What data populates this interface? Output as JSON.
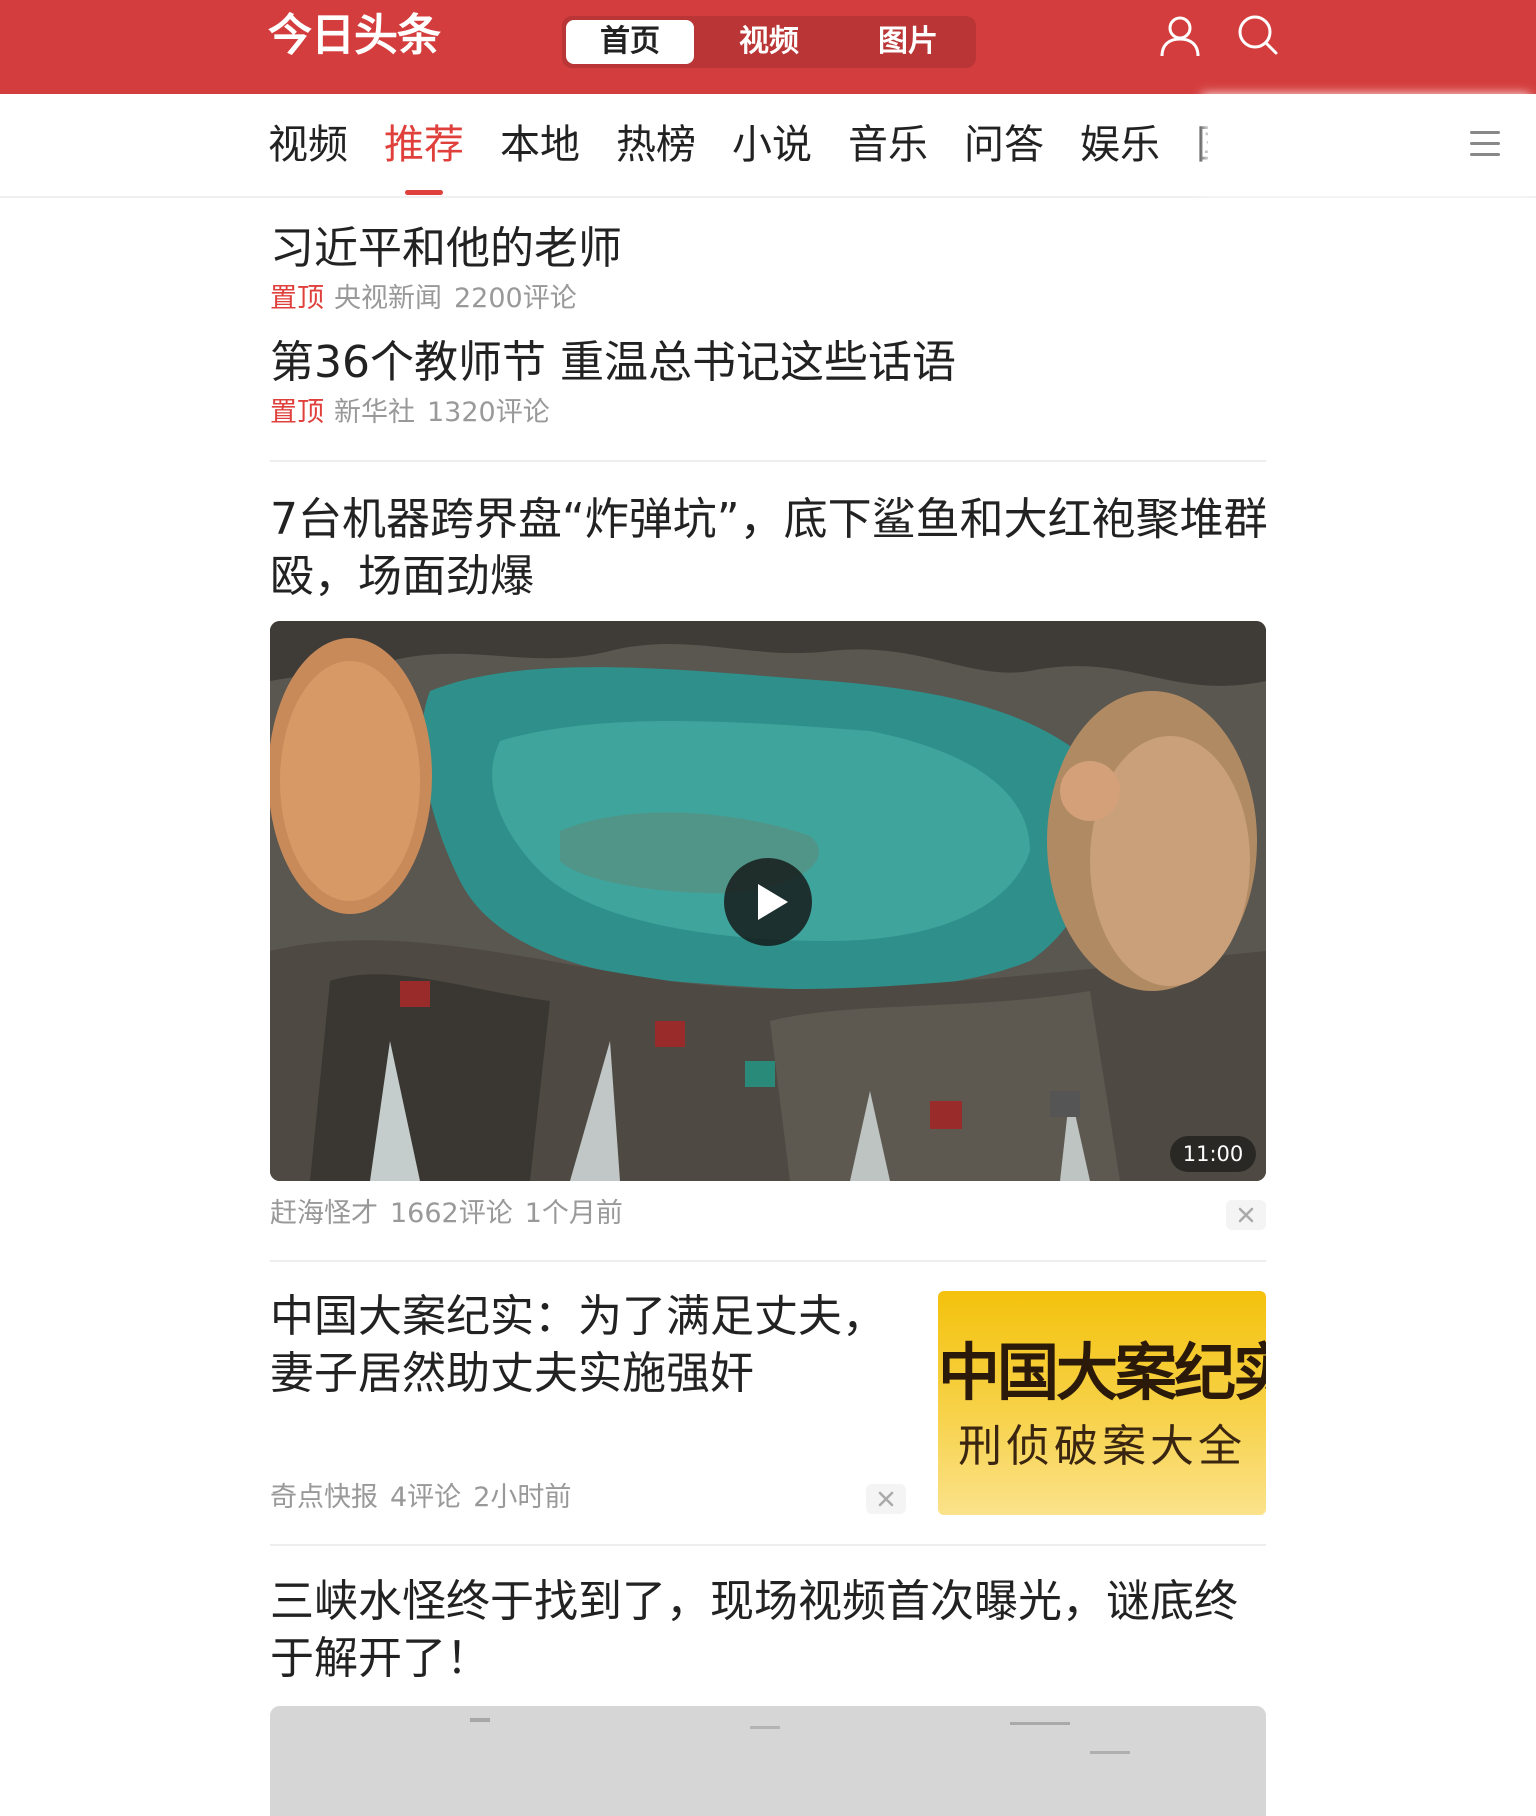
{
  "header": {
    "logo_text": "今日头条",
    "tabs": [
      {
        "label": "首页",
        "active": true
      },
      {
        "label": "视频",
        "active": false
      },
      {
        "label": "图片",
        "active": false
      }
    ],
    "icons": [
      "user-icon",
      "search-icon"
    ],
    "brand_color": "#d43d3d"
  },
  "channels": {
    "items": [
      "视频",
      "推荐",
      "本地",
      "热榜",
      "小说",
      "音乐",
      "问答",
      "娱乐",
      "国"
    ],
    "active_index": 1,
    "menu_icon": "hamburger-icon",
    "accent_color": "#e0403b"
  },
  "pinned": [
    {
      "title": "习近平和他的老师",
      "tag": "置顶",
      "source": "央视新闻",
      "comments": "2200评论"
    },
    {
      "title": "第36个教师节 重温总书记这些话语",
      "tag": "置顶",
      "source": "新华社",
      "comments": "1320评论"
    }
  ],
  "feed": {
    "video_article": {
      "title": "7台机器跨界盘“炸弹坑”，底下鲨鱼和大红袍聚堆群殴，场面劲爆",
      "duration": "11:00",
      "source": "赶海怪才",
      "comments": "1662评论",
      "time": "1个月前",
      "play_icon": "play-icon",
      "dismiss_icon": "close-icon"
    },
    "image_article": {
      "title": "中国大案纪实：为了满足丈夫，妻子居然助丈夫实施强奸",
      "thumb_line1": "中国大案纪实",
      "thumb_line2": "刑侦破案大全",
      "source": "奇点快报",
      "comments": "4评论",
      "time": "2小时前",
      "dismiss_icon": "close-icon"
    },
    "next_article": {
      "title": "三峡水怪终于找到了，现场视频首次曝光，谜底终于解开了！"
    }
  }
}
